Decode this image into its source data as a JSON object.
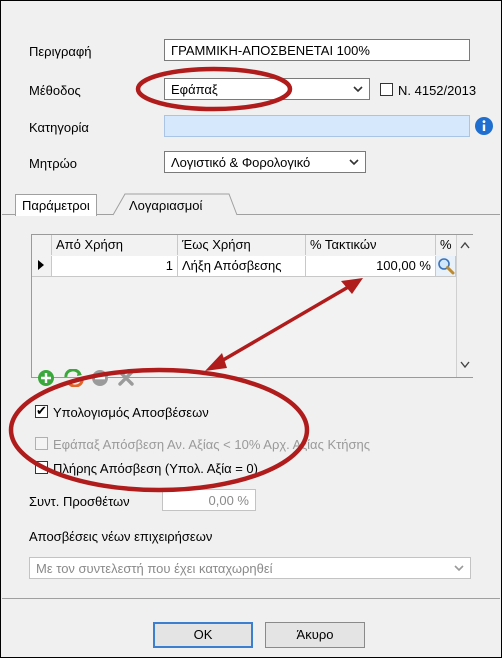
{
  "form": {
    "description_label": "Περιγραφή",
    "description_value": "ΓΡΑΜΜΙΚΗ-ΑΠΟΣΒΕΝΕΤΑΙ 100%",
    "method_label": "Μέθοδος",
    "method_value": "Εφάπαξ",
    "law_label": "Ν. 4152/2013",
    "category_label": "Κατηγορία",
    "category_value": "",
    "registry_label": "Μητρώο",
    "registry_value": "Λογιστικό & Φορολογικό"
  },
  "tabs": [
    {
      "label": "Παράμετροι",
      "active": true
    },
    {
      "label": "Λογαριασμοί",
      "active": false
    }
  ],
  "grid": {
    "columns": [
      "Από Χρήση",
      "Έως Χρήση",
      "% Τακτικών",
      "%"
    ],
    "rows": [
      {
        "from": "1",
        "to": "Λήξη Απόσβεσης",
        "percent": "100,00 %"
      }
    ]
  },
  "options": {
    "calc_depreciation_label": "Υπολογισμός Αποσβέσεων",
    "calc_depreciation_checked": true,
    "one_time_label": "Εφάπαξ Απόσβεση Αν. Αξίας < 10% Αρχ. Αξίας Κτήσης",
    "full_depreciation_label": "Πλήρης Απόσβεση (Υπολ. Αξία = 0)",
    "surcharge_label": "Συντ. Προσθέτων",
    "surcharge_value": "0,00 %",
    "new_business_label": "Αποσβέσεις νέων επιχειρήσεων",
    "new_business_value": "Με τον συντελεστή που έχει καταχωρηθεί"
  },
  "buttons": {
    "ok_label": "OK",
    "cancel_label": "Άκυρο"
  },
  "colors": {
    "annotation": "#b01c1c",
    "info": "#1f6fd0",
    "focus": "#3c7fd1"
  }
}
